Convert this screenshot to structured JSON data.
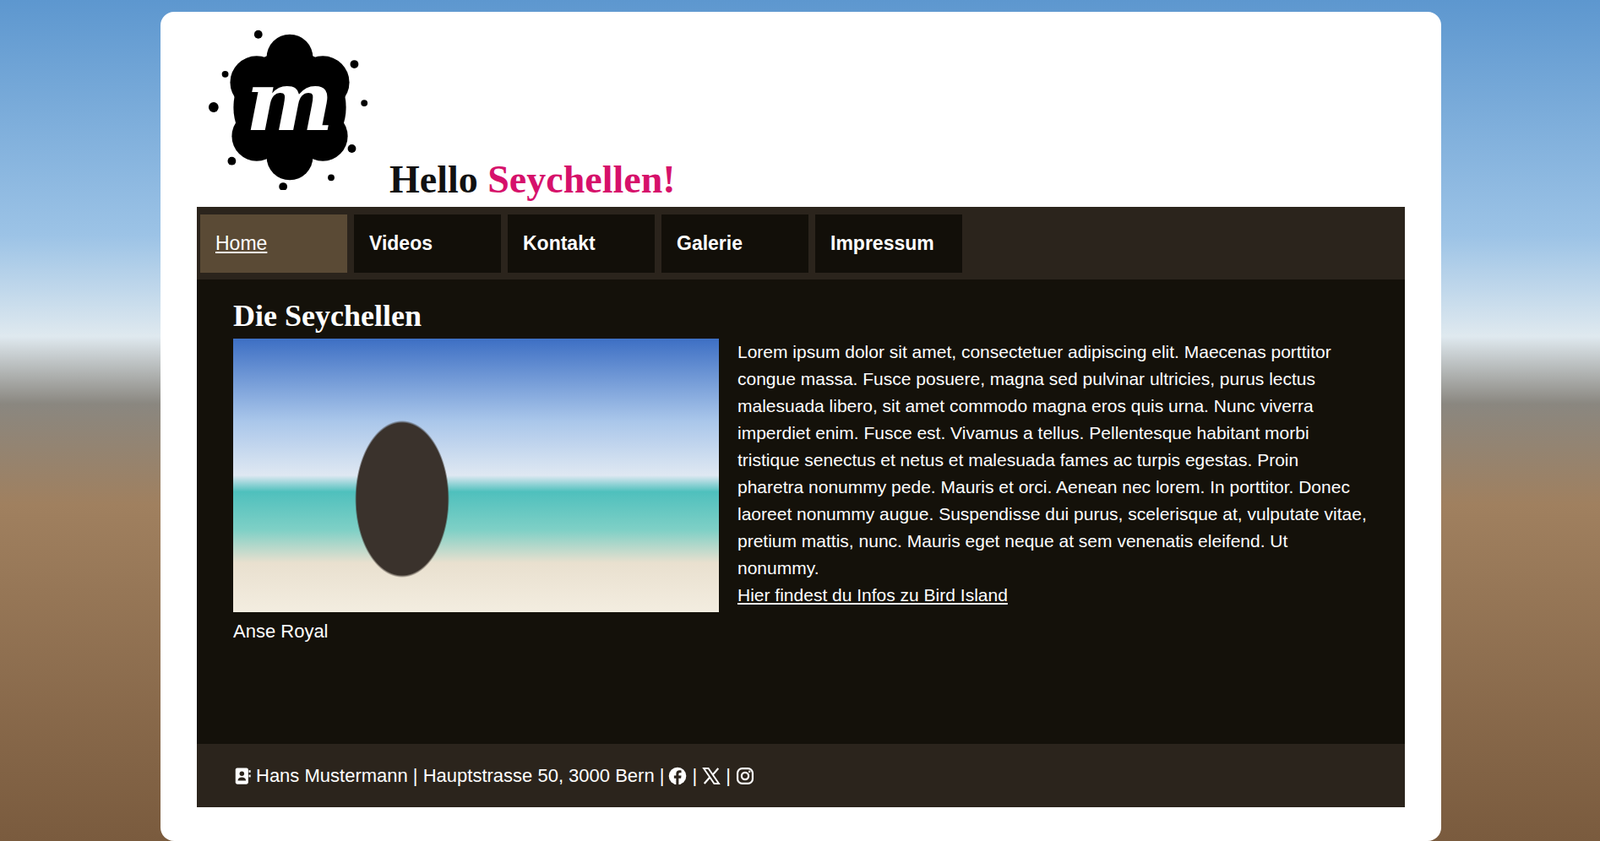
{
  "header": {
    "logo": "m",
    "title": "Hello",
    "title_accent": "Seychellen!"
  },
  "nav": [
    {
      "label": "Home",
      "selected": true
    },
    {
      "label": "Videos",
      "selected": false
    },
    {
      "label": "Kontakt",
      "selected": false
    },
    {
      "label": "Galerie",
      "selected": false
    },
    {
      "label": "Impressum",
      "selected": false
    }
  ],
  "article": {
    "heading": "Die Seychellen",
    "caption": "Anse Royal",
    "text": "Lorem ipsum dolor sit amet, consectetuer adipiscing elit. Maecenas porttitor congue massa. Fusce posuere, magna sed pulvinar ultricies, purus lectus malesuada libero, sit amet commodo magna eros quis urna. Nunc viverra imperdiet enim. Fusce est. Vivamus a tellus. Pellentesque habitant morbi tristique senectus et netus et malesuada fames ac turpis egestas. Proin pharetra nonummy pede. Mauris et orci. Aenean nec lorem. In porttitor. Donec laoreet nonummy augue. Suspendisse dui purus, scelerisque at, vulputate vitae, pretium mattis, nunc. Mauris eget neque at sem venenatis eleifend. Ut nonummy.",
    "link": "Hier findest du Infos zu Bird Island"
  },
  "footer": {
    "contact": "Hans Mustermann | Hauptstrasse 50, 3000 Bern |",
    "separators": [
      "|",
      "|"
    ]
  }
}
